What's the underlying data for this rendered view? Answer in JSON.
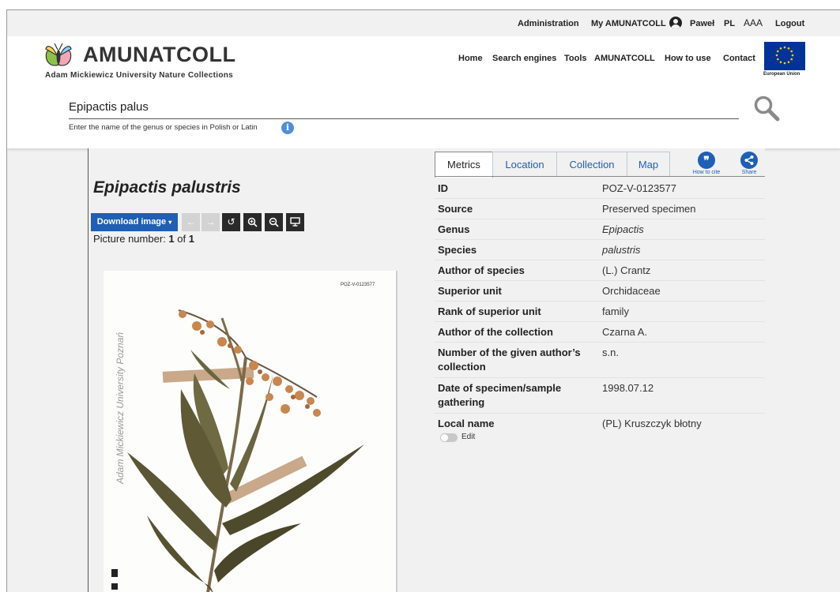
{
  "topbar": {
    "administration": "Administration",
    "my_amunatcoll": "My AMUNATCOLL",
    "user": "Paweł",
    "lang": "PL",
    "font_size": "AAA",
    "logout": "Logout"
  },
  "header": {
    "brand": "AMUNATCOLL",
    "brand_sub": "Adam Mickiewicz University Nature Collections",
    "nav": [
      "Home",
      "Search engines",
      "Tools",
      "AMUNATCOLL",
      "How to use",
      "Contact"
    ],
    "eu_label": "European Union"
  },
  "search": {
    "value": "Epipactis palus",
    "hint": "Enter the name of the genus or species in Polish or Latin",
    "info_icon": "i"
  },
  "specimen": {
    "title": "Epipactis palustris",
    "download_label": "Download image",
    "picture_label": "Picture number:",
    "picture_current": "1",
    "picture_of": "of",
    "picture_total": "1",
    "code": "POZ-V-0123577",
    "watermark": "Adam Mickiewicz University Poznań"
  },
  "tabs": {
    "items": [
      "Metrics",
      "Location",
      "Collection",
      "Map"
    ],
    "active": "Metrics",
    "cite_label": "How to cite",
    "share_label": "Share"
  },
  "metrics": [
    {
      "key": "ID",
      "value": "POZ-V-0123577",
      "italic": false
    },
    {
      "key": "Source",
      "value": "Preserved specimen",
      "italic": false
    },
    {
      "key": "Genus",
      "value": "Epipactis",
      "italic": true
    },
    {
      "key": "Species",
      "value": "palustris",
      "italic": true
    },
    {
      "key": "Author of species",
      "value": "(L.) Crantz",
      "italic": false
    },
    {
      "key": "Superior unit",
      "value": "Orchidaceae",
      "italic": false
    },
    {
      "key": "Rank of superior unit",
      "value": "family",
      "italic": false
    },
    {
      "key": "Author of the collection",
      "value": "Czarna A.",
      "italic": false
    },
    {
      "key": "Number of the given author’s collection",
      "value": "s.n.",
      "italic": false
    },
    {
      "key": "Date of specimen/sample gathering",
      "value": "1998.07.12",
      "italic": false
    },
    {
      "key": "Local name",
      "value": "(PL) Kruszczyk błotny",
      "italic": false
    }
  ],
  "edit_label": "Edit",
  "icons": {
    "user": "user-circle-icon",
    "search": "magnifier-icon",
    "info": "info-icon",
    "cite": "quote-bubble-icon",
    "share": "share-icon",
    "prev": "arrow-left-icon",
    "next": "arrow-right-icon",
    "rotate": "rotate-icon",
    "zoom_in": "zoom-in-icon",
    "zoom_out": "zoom-out-icon",
    "fullscreen": "monitor-icon"
  },
  "colors": {
    "accent": "#1f5fb5",
    "eu_blue": "#003399",
    "background": "#f1f1f1"
  }
}
